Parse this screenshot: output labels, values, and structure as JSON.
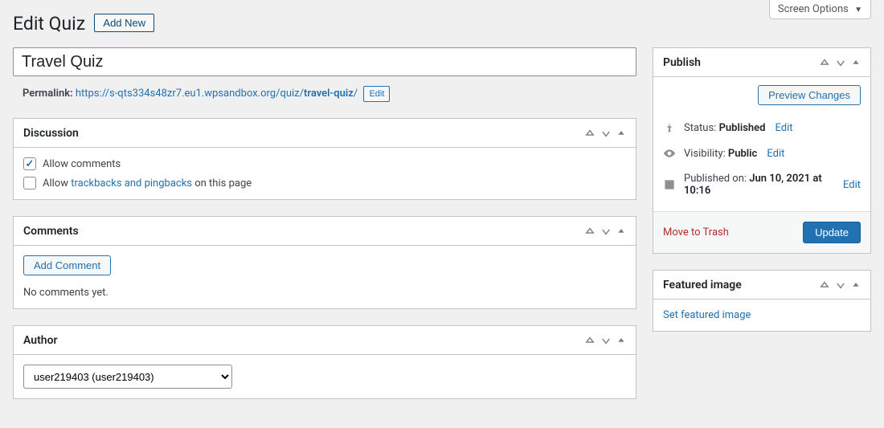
{
  "screen_options": "Screen Options",
  "page_title": "Edit Quiz",
  "add_new": "Add New",
  "title_value": "Travel Quiz",
  "permalink": {
    "label": "Permalink:",
    "base": "https://s-qts334s48zr7.eu1.wpsandbox.org/quiz/",
    "slug": "travel-quiz",
    "trail": "/",
    "edit": "Edit"
  },
  "discussion": {
    "heading": "Discussion",
    "allow_comments": "Allow comments",
    "allow_prefix": "Allow ",
    "trackbacks_link": "trackbacks and pingbacks",
    "allow_suffix": " on this page"
  },
  "comments": {
    "heading": "Comments",
    "add_comment": "Add Comment",
    "empty": "No comments yet."
  },
  "author": {
    "heading": "Author",
    "value": "user219403 (user219403)"
  },
  "publish": {
    "heading": "Publish",
    "preview": "Preview Changes",
    "status_label": "Status:",
    "status_value": "Published",
    "visibility_label": "Visibility:",
    "visibility_value": "Public",
    "date_label": "Published on:",
    "date_value": "Jun 10, 2021 at 10:16",
    "edit": "Edit",
    "trash": "Move to Trash",
    "update": "Update"
  },
  "featured": {
    "heading": "Featured image",
    "set_link": "Set featured image"
  }
}
